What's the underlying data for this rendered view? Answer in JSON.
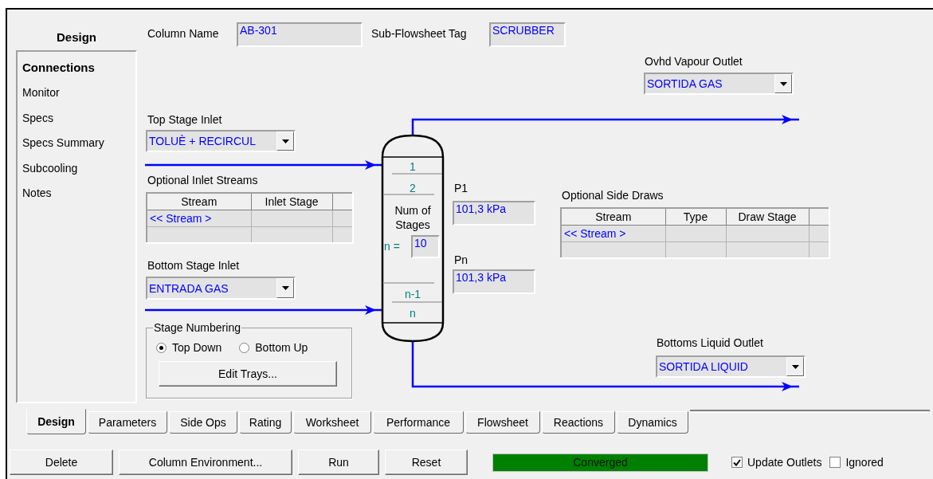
{
  "sidebar": {
    "header": "Design",
    "items": [
      {
        "label": "Connections",
        "selected": true
      },
      {
        "label": "Monitor",
        "selected": false
      },
      {
        "label": "Specs",
        "selected": false
      },
      {
        "label": "Specs Summary",
        "selected": false
      },
      {
        "label": "Subcooling",
        "selected": false
      },
      {
        "label": "Notes",
        "selected": false
      }
    ]
  },
  "connections": {
    "column_name": {
      "label": "Column Name",
      "value": "AB-301"
    },
    "sub_flowsheet_tag": {
      "label": "Sub-Flowsheet Tag",
      "value": "SCRUBBER"
    },
    "ovhd_vapour_outlet": {
      "label": "Ovhd Vapour Outlet",
      "value": "SORTIDA GAS"
    },
    "top_stage_inlet": {
      "label": "Top Stage Inlet",
      "value": "TOLUÈ + RECIRCUL"
    },
    "optional_inlet_streams": {
      "title": "Optional Inlet Streams",
      "columns": [
        "Stream",
        "Inlet Stage"
      ],
      "rows": [
        [
          "<< Stream >"
        ]
      ]
    },
    "bottom_stage_inlet": {
      "label": "Bottom Stage Inlet",
      "value": "ENTRADA GAS"
    },
    "stage_numbering": {
      "title": "Stage Numbering",
      "options": [
        {
          "label": "Top Down",
          "selected": true
        },
        {
          "label": "Bottom Up",
          "selected": false
        }
      ],
      "button": "Edit Trays..."
    },
    "column": {
      "top_stages": [
        "1",
        "2"
      ],
      "num_stages_label": "Num of Stages",
      "n_label": "n =",
      "n_value": "10",
      "bottom_stages": [
        "n-1",
        "n"
      ]
    },
    "p1": {
      "label": "P1",
      "value": "101,3 kPa"
    },
    "pn": {
      "label": "Pn",
      "value": "101,3 kPa"
    },
    "optional_side_draws": {
      "title": "Optional Side Draws",
      "columns": [
        "Stream",
        "Type",
        "Draw Stage"
      ],
      "rows": [
        [
          "<< Stream >"
        ]
      ]
    },
    "bottoms_liquid_outlet": {
      "label": "Bottoms Liquid Outlet",
      "value": "SORTIDA LIQUID"
    }
  },
  "tabs": [
    {
      "label": "Design",
      "selected": true
    },
    {
      "label": "Parameters",
      "selected": false
    },
    {
      "label": "Side Ops",
      "selected": false
    },
    {
      "label": "Rating",
      "selected": false
    },
    {
      "label": "Worksheet",
      "selected": false
    },
    {
      "label": "Performance",
      "selected": false
    },
    {
      "label": "Flowsheet",
      "selected": false
    },
    {
      "label": "Reactions",
      "selected": false
    },
    {
      "label": "Dynamics",
      "selected": false
    }
  ],
  "buttons": [
    "Delete",
    "Column Environment...",
    "Run",
    "Reset"
  ],
  "status": "Converged",
  "checkboxes": [
    {
      "label": "Update Outlets",
      "checked": true
    },
    {
      "label": "Ignored",
      "checked": false
    }
  ]
}
